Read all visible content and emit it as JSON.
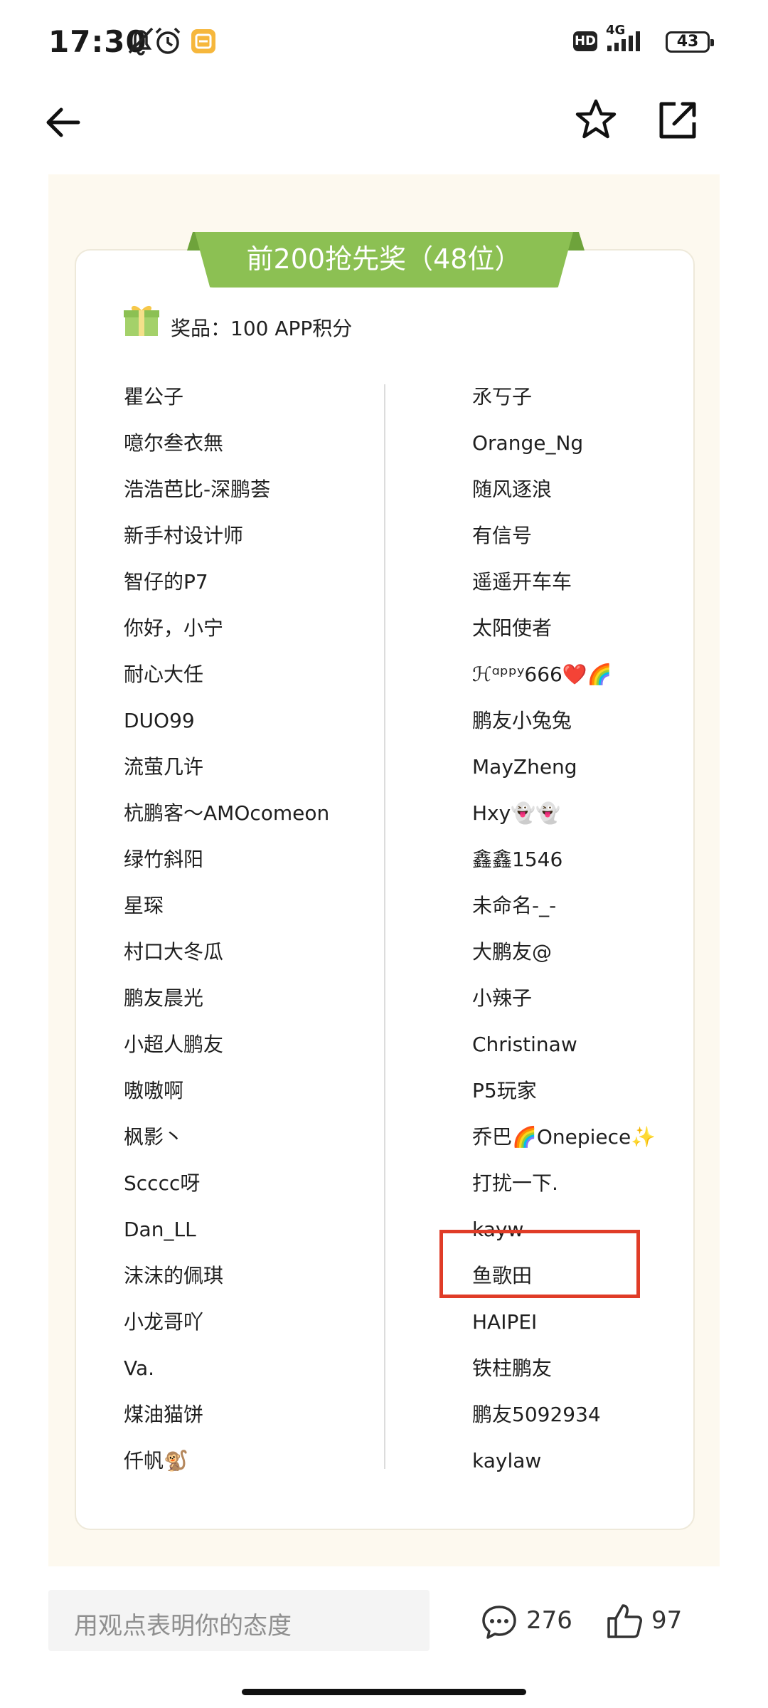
{
  "status_bar": {
    "time": "17:30",
    "network": "4G",
    "hd_label": "HD",
    "battery": "43",
    "icons": [
      "bell-off-icon",
      "alarm-icon",
      "app-notification-icon",
      "signal-icon"
    ]
  },
  "nav": {
    "icons": [
      "back-arrow-icon",
      "star-icon",
      "share-icon"
    ]
  },
  "award": {
    "title": "前200抢先奖（48位）",
    "prize": "奖品：100 APP积分",
    "left_names": [
      "瞿公子",
      "噫尔叁衣無",
      "浩浩芭比-深鹏荟",
      "新手村设计师",
      "智仔的P7",
      "你好，小宁",
      "耐心大任",
      "DUO99",
      "流萤几许",
      "杭鹏客～AMOcomeon",
      "绿竹斜阳",
      "星琛",
      "村口大冬瓜",
      "鹏友晨光",
      "小超人鹏友",
      "嗷嗷啊",
      "枫影丶",
      "Scccc呀",
      "Dan_LL",
      "沫沫的佩琪",
      "小龙哥吖",
      "Va.",
      "煤油猫饼",
      "仟帆🐒"
    ],
    "right_names": [
      "氶丂子",
      "Orange_Ng",
      "随风逐浪",
      "有信号",
      "遥遥开车车",
      "太阳使者",
      "ℋᵅᵖᵖʸ666❤️🌈",
      "鹏友小兔兔",
      "MayZheng",
      "Hxy👻👻",
      "鑫鑫1546",
      "未命名-_-",
      "大鹏友@",
      "小辣子",
      "Christinaw",
      "P5玩家",
      "乔巴🌈Onepiece✨",
      "打扰一下.",
      "kayw",
      "鱼歌田",
      "HAIPEI",
      "铁柱鹏友",
      "鹏友5092934",
      "kaylaw"
    ],
    "highlight_color": "#e03c27",
    "ribbon_color": "#8cc053"
  },
  "footer": {
    "comment_placeholder": "用观点表明你的态度",
    "comment_count": "276",
    "like_count": "97"
  }
}
